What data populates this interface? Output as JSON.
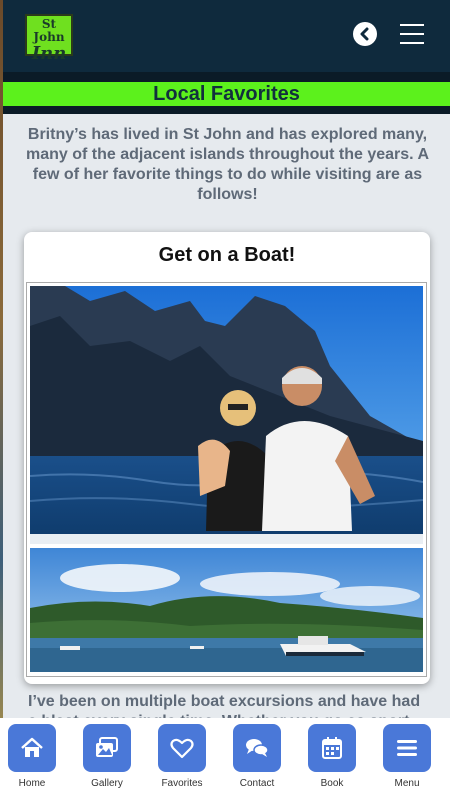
{
  "header": {
    "logo_line1": "St John",
    "logo_line2": "Inn",
    "back_icon": "chevron-left-icon",
    "menu_icon": "hamburger-icon"
  },
  "banner": {
    "title": "Local Favorites"
  },
  "intro": {
    "text": "Britny’s  has lived in St John and has explored many, many of the adjacent islands throughout the years.  A few of her favorite things to do while visiting are as follows!"
  },
  "card": {
    "title": "Get on a Boat!"
  },
  "body": {
    "text": "I’ve been on multiple boat excursions and have had a blast every single time. Whether you go as sport"
  },
  "nav": {
    "items": [
      {
        "label": "Home",
        "icon": "home-icon"
      },
      {
        "label": "Gallery",
        "icon": "gallery-icon"
      },
      {
        "label": "Favorites",
        "icon": "heart-icon"
      },
      {
        "label": "Contact",
        "icon": "chat-icon"
      },
      {
        "label": "Book",
        "icon": "calendar-icon"
      },
      {
        "label": "Menu",
        "icon": "hamburger-icon"
      }
    ]
  },
  "colors": {
    "topbar": "#0f2a3d",
    "accent_green": "#5cf11c",
    "nav_tile": "#4a78d8",
    "text_gray": "#5f6a78"
  }
}
